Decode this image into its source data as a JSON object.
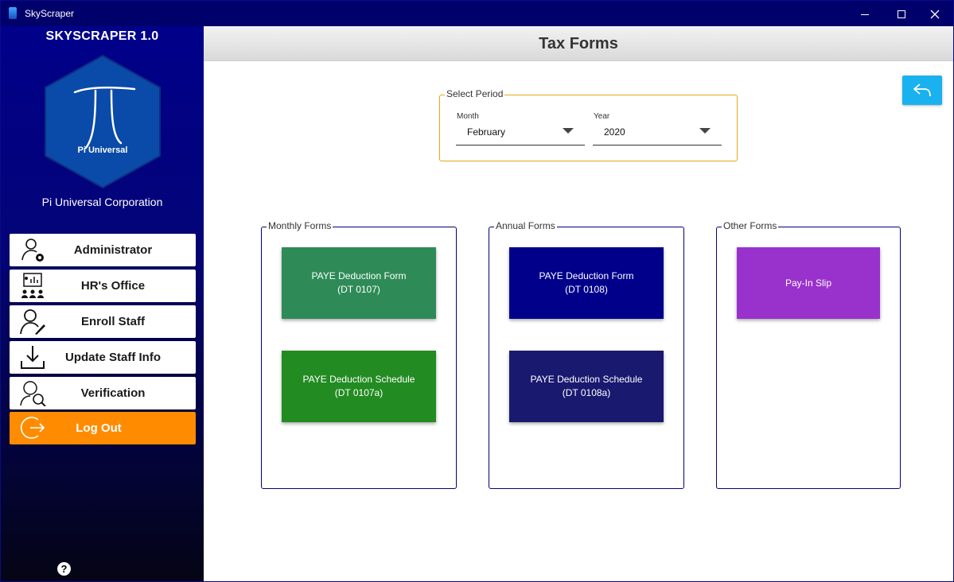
{
  "window": {
    "title": "SkyScraper"
  },
  "sidebar": {
    "brand": "SKYSCRAPER 1.0",
    "logo_text": "Pi Universal",
    "company": "Pi Universal Corporation",
    "items": [
      {
        "label": "Administrator",
        "icon": "admin-gear-icon"
      },
      {
        "label": "HR's Office",
        "icon": "presentation-icon"
      },
      {
        "label": "Enroll Staff",
        "icon": "user-edit-icon"
      },
      {
        "label": "Update Staff Info",
        "icon": "download-icon"
      },
      {
        "label": "Verification",
        "icon": "face-scan-icon"
      },
      {
        "label": "Log Out",
        "icon": "logout-icon"
      }
    ],
    "help_label": "?"
  },
  "header": {
    "title": "Tax Forms"
  },
  "period": {
    "legend": "Select Period",
    "month": {
      "label": "Month",
      "value": "February"
    },
    "year": {
      "label": "Year",
      "value": "2020"
    }
  },
  "groups": {
    "monthly": {
      "legend": "Monthly Forms",
      "tiles": [
        {
          "line1": "PAYE Deduction Form",
          "line2": "(DT 0107)",
          "color": "#2e8b57"
        },
        {
          "line1": "PAYE Deduction Schedule",
          "line2": "(DT 0107a)",
          "color": "#228b22"
        }
      ]
    },
    "annual": {
      "legend": "Annual Forms",
      "tiles": [
        {
          "line1": "PAYE Deduction Form",
          "line2": "(DT 0108)",
          "color": "#00008b"
        },
        {
          "line1": "PAYE Deduction Schedule",
          "line2": "(DT 0108a)",
          "color": "#191970"
        }
      ]
    },
    "other": {
      "legend": "Other Forms",
      "tiles": [
        {
          "line1": "Pay-In Slip",
          "color": "#9932cc"
        }
      ]
    }
  },
  "colors": {
    "accent_orange": "#ff8c00",
    "back_button": "#1ab2ee",
    "sidebar_top": "#00008a",
    "period_border": "#e6a817"
  }
}
